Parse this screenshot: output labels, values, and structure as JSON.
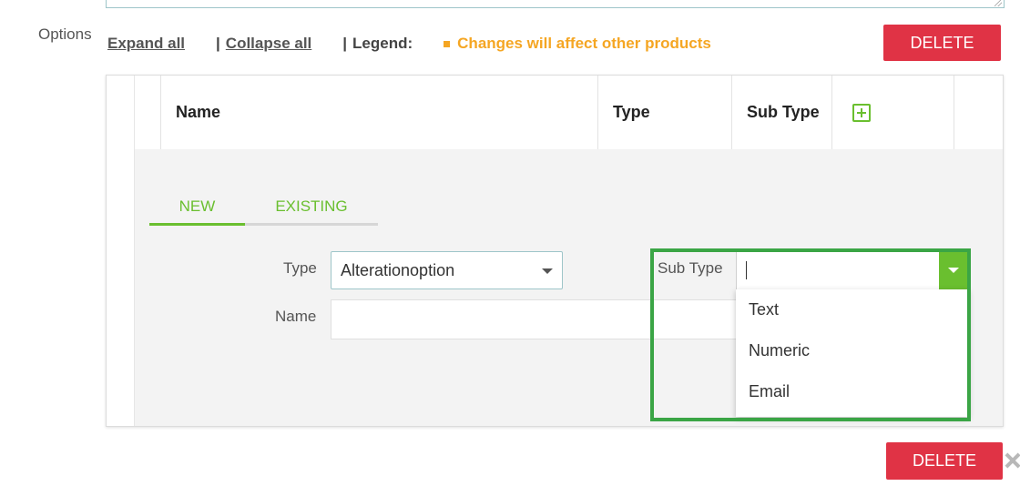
{
  "options_label": "Options",
  "toolbar": {
    "expand_all": "Expand all",
    "collapse_all": "Collapse all",
    "sep": "|",
    "legend_label": "Legend:",
    "legend_item": "Changes will affect other products"
  },
  "delete_label": "DELETE",
  "grid": {
    "columns": [
      "Name",
      "Type",
      "Sub Type"
    ]
  },
  "tabs": {
    "new": "NEW",
    "existing": "EXISTING",
    "active": "NEW"
  },
  "form": {
    "type_label": "Type",
    "type_value": "Alterationoption",
    "name_label": "Name",
    "name_value": "",
    "subtype_label": "Sub Type",
    "subtype_value": ""
  },
  "subtype_options": [
    "Text",
    "Numeric",
    "Email"
  ],
  "colors": {
    "accent": "#6abf2f",
    "danger": "#e03345",
    "legend": "#f5a623",
    "highlight": "#3aa545"
  },
  "icons": {
    "add": "plus-square-icon",
    "clear": "close-icon",
    "dropdown": "chevron-down-icon"
  }
}
